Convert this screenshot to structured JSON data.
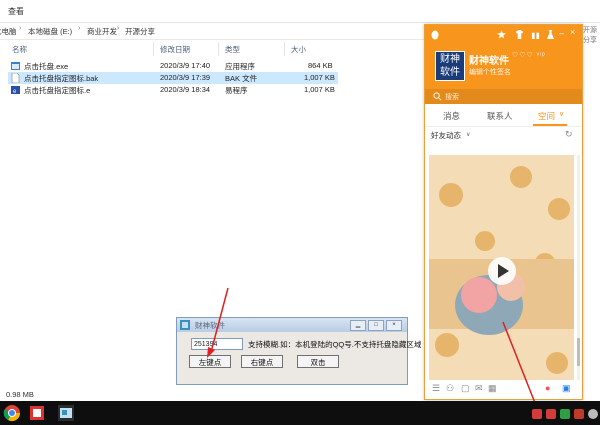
{
  "explorer": {
    "menu_view": "查看",
    "breadcrumb": [
      "此电脑",
      "本地磁盘 (E:)",
      "商业开发",
      "开源分享"
    ],
    "search_stub": "开源分享",
    "columns": {
      "name": "名称",
      "date": "修改日期",
      "type": "类型",
      "size": "大小"
    },
    "files": [
      {
        "name": "点击托盘.exe",
        "date": "2020/3/9 17:40",
        "type": "应用程序",
        "size": "864 KB",
        "icon": "exe-icon"
      },
      {
        "name": "点击托盘指定图标.bak",
        "date": "2020/3/9 17:39",
        "type": "BAK 文件",
        "size": "1,007 KB",
        "icon": "file-icon",
        "selected": true
      },
      {
        "name": "点击托盘指定图标.e",
        "date": "2020/3/9 18:34",
        "type": "易程序",
        "size": "1,007 KB",
        "icon": "e-source-icon"
      }
    ],
    "status": "0.98 MB"
  },
  "qq": {
    "avatar_text": "财神\n软件",
    "nickname": "财神软件",
    "badges": "♡♡♡ ᵛᶦᵖ",
    "signature": "编辑个性签名",
    "search_placeholder": "搜索",
    "tabs": [
      "消息",
      "联系人",
      "空间"
    ],
    "active_tab": 2,
    "feed_title": "好友动态",
    "accent_color": "#f7951d"
  },
  "tool": {
    "title": "财神软件",
    "input_value": "251394",
    "description": "支持模糊.如：本机登陆的QQ号.不支持托盘隐藏区域",
    "buttons": [
      "左键点",
      "右键点",
      "双击"
    ]
  }
}
